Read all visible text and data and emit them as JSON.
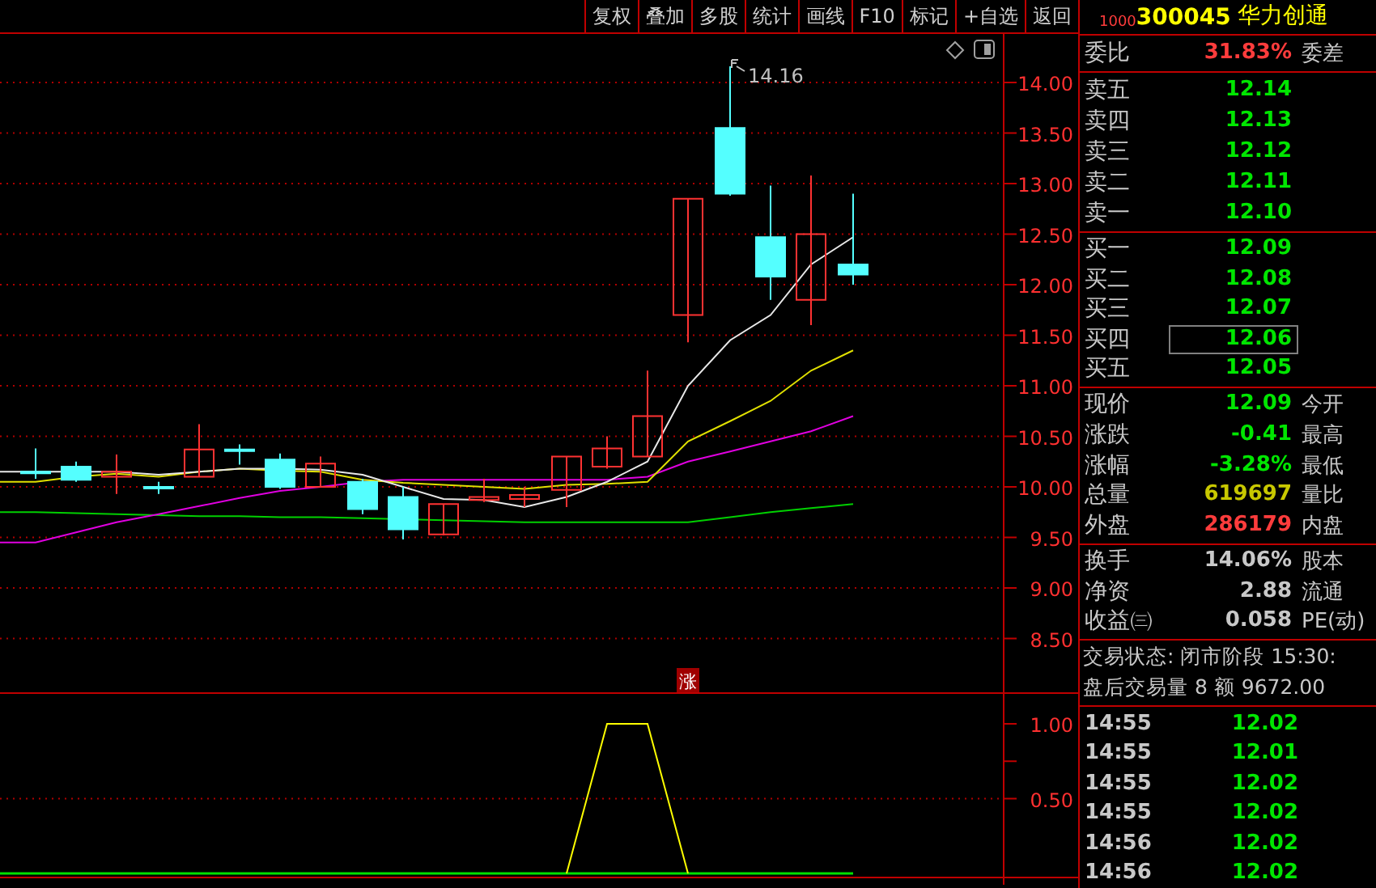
{
  "toolbar": [
    "复权",
    "叠加",
    "多股",
    "统计",
    "画线",
    "F10",
    "标记",
    "+自选",
    "返回"
  ],
  "price_chart": {
    "price_ticks": [
      "14.00",
      "13.50",
      "13.00",
      "12.50",
      "12.00",
      "11.50",
      "11.00",
      "10.50",
      "10.00",
      "9.50",
      "9.00",
      "8.50"
    ],
    "high_label": "14.16",
    "badge": "涨"
  },
  "indicator_chart": {
    "axis_ticks": [
      "1.00",
      "0.50"
    ]
  },
  "quote_panel": {
    "code_prefix": "1000",
    "code": "300045",
    "name": "华力创通",
    "ratio_row": {
      "label": "委比",
      "value": "31.83%",
      "tail": "委差"
    },
    "asks": [
      {
        "label": "卖五",
        "price": "12.14"
      },
      {
        "label": "卖四",
        "price": "12.13"
      },
      {
        "label": "卖三",
        "price": "12.12"
      },
      {
        "label": "卖二",
        "price": "12.11"
      },
      {
        "label": "卖一",
        "price": "12.10"
      }
    ],
    "bids": [
      {
        "label": "买一",
        "price": "12.09",
        "selected": false
      },
      {
        "label": "买二",
        "price": "12.08",
        "selected": false
      },
      {
        "label": "买三",
        "price": "12.07",
        "selected": false
      },
      {
        "label": "买四",
        "price": "12.06",
        "selected": true
      },
      {
        "label": "买五",
        "price": "12.05",
        "selected": false
      }
    ],
    "stats": [
      {
        "label": "现价",
        "value": "12.09",
        "color": "#00e600",
        "tail": "今开"
      },
      {
        "label": "涨跌",
        "value": "-0.41",
        "color": "#00e600",
        "tail": "最高"
      },
      {
        "label": "涨幅",
        "value": "-3.28%",
        "color": "#00e600",
        "tail": "最低"
      },
      {
        "label": "总量",
        "value": "619697",
        "color": "#c8c800",
        "tail": "量比"
      },
      {
        "label": "外盘",
        "value": "286179",
        "color": "#ff3c3c",
        "tail": "内盘"
      }
    ],
    "fundamentals": [
      {
        "label": "换手",
        "value": "14.06%",
        "tail": "股本"
      },
      {
        "label": "净资",
        "value": "2.88",
        "tail": "流通"
      },
      {
        "label": "收益㈢",
        "value": "0.058",
        "tail": "PE(动)"
      }
    ],
    "status_lines": [
      "交易状态: 闭市阶段 15:30:",
      "盘后交易量 8 额 9672.00"
    ],
    "trades": [
      {
        "time": "14:55",
        "price": "12.02"
      },
      {
        "time": "14:55",
        "price": "12.01"
      },
      {
        "time": "14:55",
        "price": "12.02"
      },
      {
        "time": "14:55",
        "price": "12.02"
      },
      {
        "time": "14:56",
        "price": "12.02"
      },
      {
        "time": "14:56",
        "price": "12.02"
      }
    ]
  }
}
